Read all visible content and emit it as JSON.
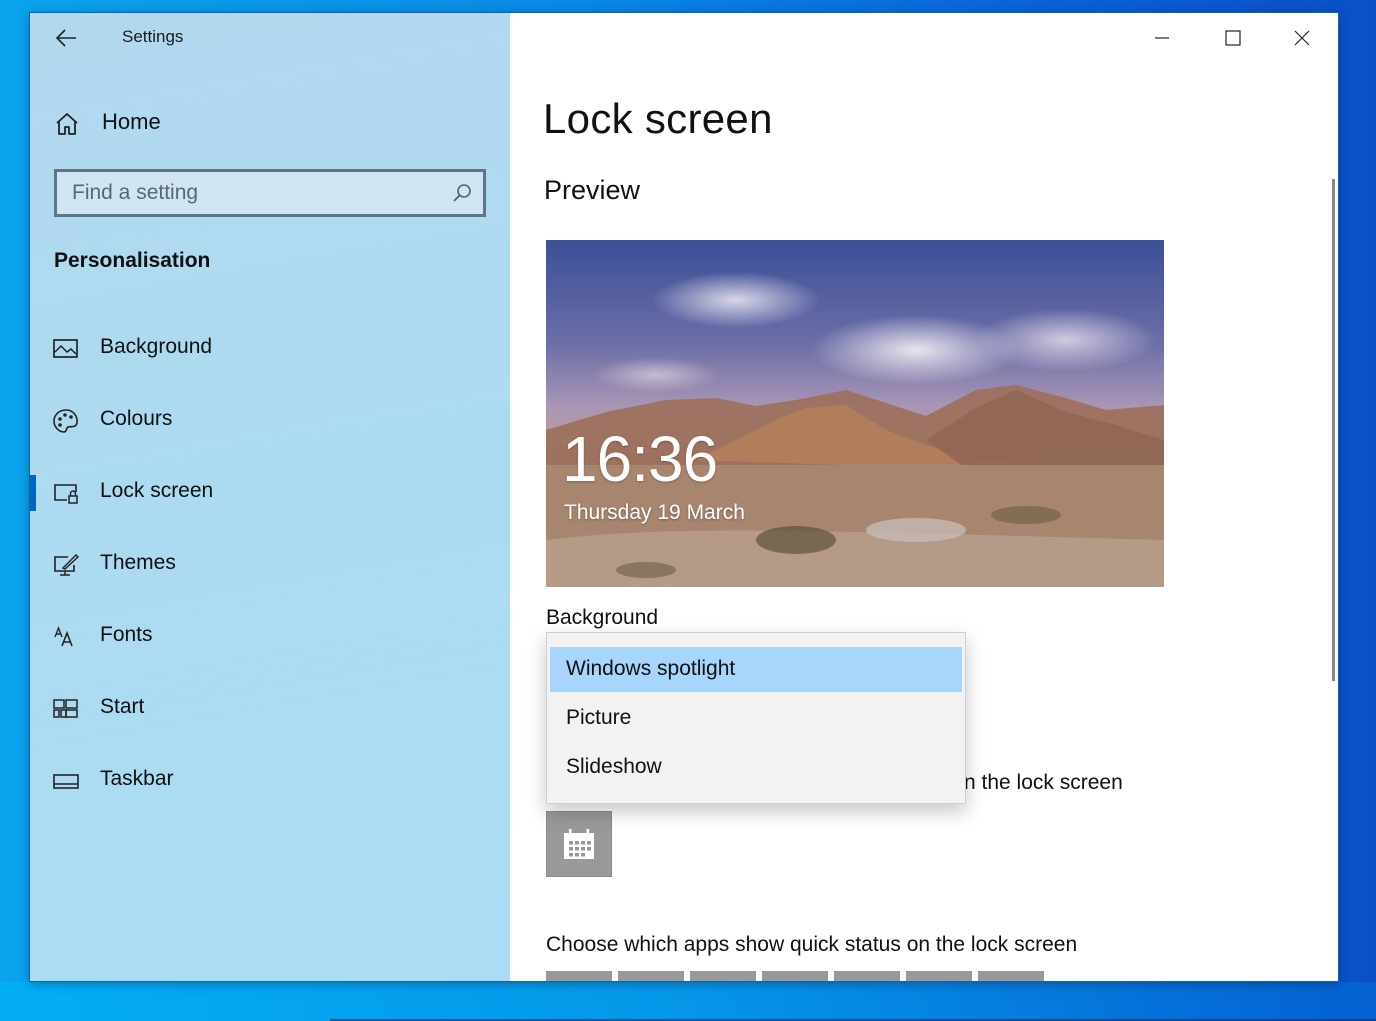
{
  "window": {
    "app_title": "Settings",
    "controls": {
      "minimize": "minimize-icon",
      "maximize": "maximize-icon",
      "close": "close-icon"
    }
  },
  "sidebar": {
    "back_icon": "back-arrow-icon",
    "home": {
      "label": "Home",
      "icon": "home-icon"
    },
    "search": {
      "placeholder": "Find a setting",
      "value": "",
      "icon": "search-icon"
    },
    "section_title": "Personalisation",
    "items": [
      {
        "label": "Background",
        "icon": "picture-icon",
        "active": false
      },
      {
        "label": "Colours",
        "icon": "palette-icon",
        "active": false
      },
      {
        "label": "Lock screen",
        "icon": "lock-screen-icon",
        "active": true
      },
      {
        "label": "Themes",
        "icon": "themes-icon",
        "active": false
      },
      {
        "label": "Fonts",
        "icon": "fonts-icon",
        "active": false
      },
      {
        "label": "Start",
        "icon": "start-icon",
        "active": false
      },
      {
        "label": "Taskbar",
        "icon": "taskbar-icon",
        "active": false
      }
    ],
    "accent_color": "#0067c0"
  },
  "main": {
    "title": "Lock screen",
    "preview_heading": "Preview",
    "preview": {
      "time": "16:36",
      "date": "Thursday 19 March"
    },
    "background_label": "Background",
    "background_dropdown": {
      "options": [
        "Windows spotlight",
        "Picture",
        "Slideshow"
      ],
      "selected": "Windows spotlight",
      "highlight_color": "#a7d5fb"
    },
    "detailed_status_text_partial": "n the lock screen",
    "detailed_status_app_icon": "calendar-icon",
    "quick_status_heading": "Choose which apps show quick status on the lock screen",
    "quick_status_tile_count": 7
  }
}
